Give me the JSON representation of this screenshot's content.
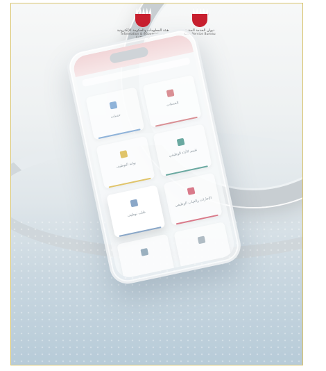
{
  "header": {
    "logo_left": {
      "arabic": "هيئة المعلومات والحكومة الإلكترونية",
      "english": "Information & eGovernment Authority"
    },
    "logo_right": {
      "arabic": "ديوان الخدمة المدنية",
      "english": "Civil Service Bureau"
    }
  },
  "phone": {
    "tiles": [
      {
        "label": "خدمات",
        "accent": "#8fb3d9",
        "underline": "#8fb3d9"
      },
      {
        "label": "الخدمات",
        "accent": "#d98f94",
        "underline": "#d98f94"
      },
      {
        "label": "بوابة التوظيف",
        "accent": "#e0c46a",
        "underline": "#e0c46a"
      },
      {
        "label": "تقييم الأداء الوظيفي",
        "accent": "#6aa9a1",
        "underline": "#6aa9a1"
      },
      {
        "label": "طلب توظيف",
        "accent": "#8aa7c8",
        "underline": "#8aa7c8"
      },
      {
        "label": "الإجازات والغياب الوظيفي",
        "accent": "#d97a8a",
        "underline": "#d97a8a"
      },
      {
        "label": "",
        "accent": "#9ab0bf",
        "underline": "#c8d3da"
      },
      {
        "label": "",
        "accent": "#b0bcc4",
        "underline": "#c8d3da"
      }
    ]
  },
  "colors": {
    "frame_border": "#d8c36c",
    "shield_red": "#c8202f"
  }
}
